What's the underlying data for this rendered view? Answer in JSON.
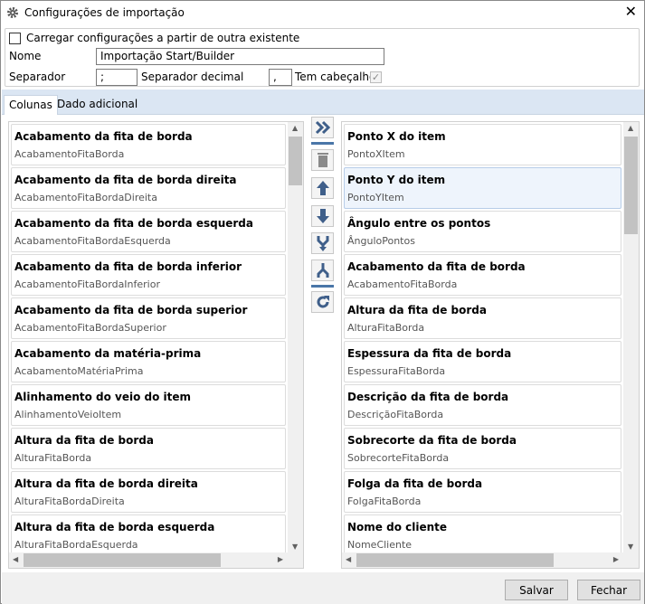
{
  "window": {
    "title": "Configurações de importação"
  },
  "form": {
    "load_existing_label": "Carregar configurações a partir de outra existente",
    "name_label": "Nome",
    "name_value": "Importação Start/Builder",
    "separator_label": "Separador",
    "separator_value": ";",
    "decimal_label": "Separador decimal",
    "decimal_value": ",",
    "header_label": "Tem cabeçalho",
    "header_checked": true
  },
  "tabs": [
    {
      "label": "Colunas"
    },
    {
      "label": "Dado adicional"
    }
  ],
  "available": [
    {
      "title": "Acabamento da fita de borda",
      "field": "AcabamentoFitaBorda"
    },
    {
      "title": "Acabamento da fita de borda direita",
      "field": "AcabamentoFitaBordaDireita"
    },
    {
      "title": "Acabamento da fita de borda esquerda",
      "field": "AcabamentoFitaBordaEsquerda"
    },
    {
      "title": "Acabamento da fita de borda inferior",
      "field": "AcabamentoFitaBordaInferior"
    },
    {
      "title": "Acabamento da fita de borda superior",
      "field": "AcabamentoFitaBordaSuperior"
    },
    {
      "title": "Acabamento da matéria-prima",
      "field": "AcabamentoMatériaPrima"
    },
    {
      "title": "Alinhamento do veio do item",
      "field": "AlinhamentoVeioItem"
    },
    {
      "title": "Altura da fita de borda",
      "field": "AlturaFitaBorda"
    },
    {
      "title": "Altura da fita de borda direita",
      "field": "AlturaFitaBordaDireita"
    },
    {
      "title": "Altura da fita de borda esquerda",
      "field": "AlturaFitaBordaEsquerda"
    }
  ],
  "selected": [
    {
      "title": "Ponto X do item",
      "field": "PontoXItem"
    },
    {
      "title": "Ponto Y do item",
      "field": "PontoYItem"
    },
    {
      "title": "Ângulo entre os pontos",
      "field": "ÂnguloPontos"
    },
    {
      "title": "Acabamento da fita de borda",
      "field": "AcabamentoFitaBorda"
    },
    {
      "title": "Altura da fita de borda",
      "field": "AlturaFitaBorda"
    },
    {
      "title": "Espessura da fita de borda",
      "field": "EspessuraFitaBorda"
    },
    {
      "title": "Descrição da fita de borda",
      "field": "DescriçãoFitaBorda"
    },
    {
      "title": "Sobrecorte da fita de borda",
      "field": "SobrecorteFitaBorda"
    },
    {
      "title": "Folga da fita de borda",
      "field": "FolgaFitaBorda"
    },
    {
      "title": "Nome do cliente",
      "field": "NomeCliente"
    }
  ],
  "buttons": {
    "save": "Salvar",
    "close": "Fechar"
  },
  "colors": {
    "icon": "#3f5f8a",
    "tab_strip": "#dbe6f3"
  }
}
